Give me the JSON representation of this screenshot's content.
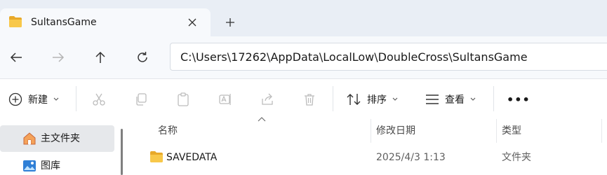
{
  "tab": {
    "title": "SultansGame",
    "icon": "folder-icon"
  },
  "address": {
    "path": "C:\\Users\\17262\\AppData\\LocalLow\\DoubleCross\\SultansGame"
  },
  "toolbar": {
    "new_label": "新建",
    "sort_label": "排序",
    "view_label": "查看",
    "more_label": "•••"
  },
  "sidebar": {
    "items": [
      {
        "label": "主文件夹",
        "icon": "home-icon",
        "selected": true
      },
      {
        "label": "图库",
        "icon": "gallery-icon",
        "selected": false
      }
    ]
  },
  "columns": {
    "name": "名称",
    "date": "修改日期",
    "type": "类型"
  },
  "files": [
    {
      "name": "SAVEDATA",
      "date": "2025/4/3 1:13",
      "type": "文件夹",
      "icon": "folder-icon"
    }
  ],
  "colors": {
    "tab_bar": "#e9eef5",
    "folder": "#f8c84a",
    "selected_nav": "#e6e8eb"
  }
}
